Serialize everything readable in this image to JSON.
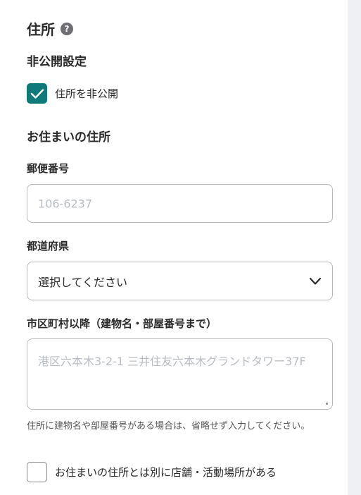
{
  "section": {
    "title": "住所",
    "help_icon": "?"
  },
  "privacy": {
    "heading": "非公開設定",
    "checkbox_label": "住所を非公開",
    "checked": true
  },
  "residence": {
    "heading": "お住まいの住所"
  },
  "postal": {
    "label": "郵便番号",
    "placeholder": "106-6237",
    "value": ""
  },
  "prefecture": {
    "label": "都道府県",
    "selected": "選択してください"
  },
  "address": {
    "label": "市区町村以降（建物名・部屋番号まで）",
    "placeholder": "港区六本木3-2-1 三井住友六本木グランドタワー37F",
    "help": "住所に建物名や部屋番号がある場合は、省略せず入力してください。"
  },
  "store": {
    "checkbox_label": "お住まいの住所とは別に店舗・活動場所がある",
    "checked": false
  },
  "colors": {
    "accent": "#0f7a7a",
    "placeholder": "#b8bdc4"
  }
}
